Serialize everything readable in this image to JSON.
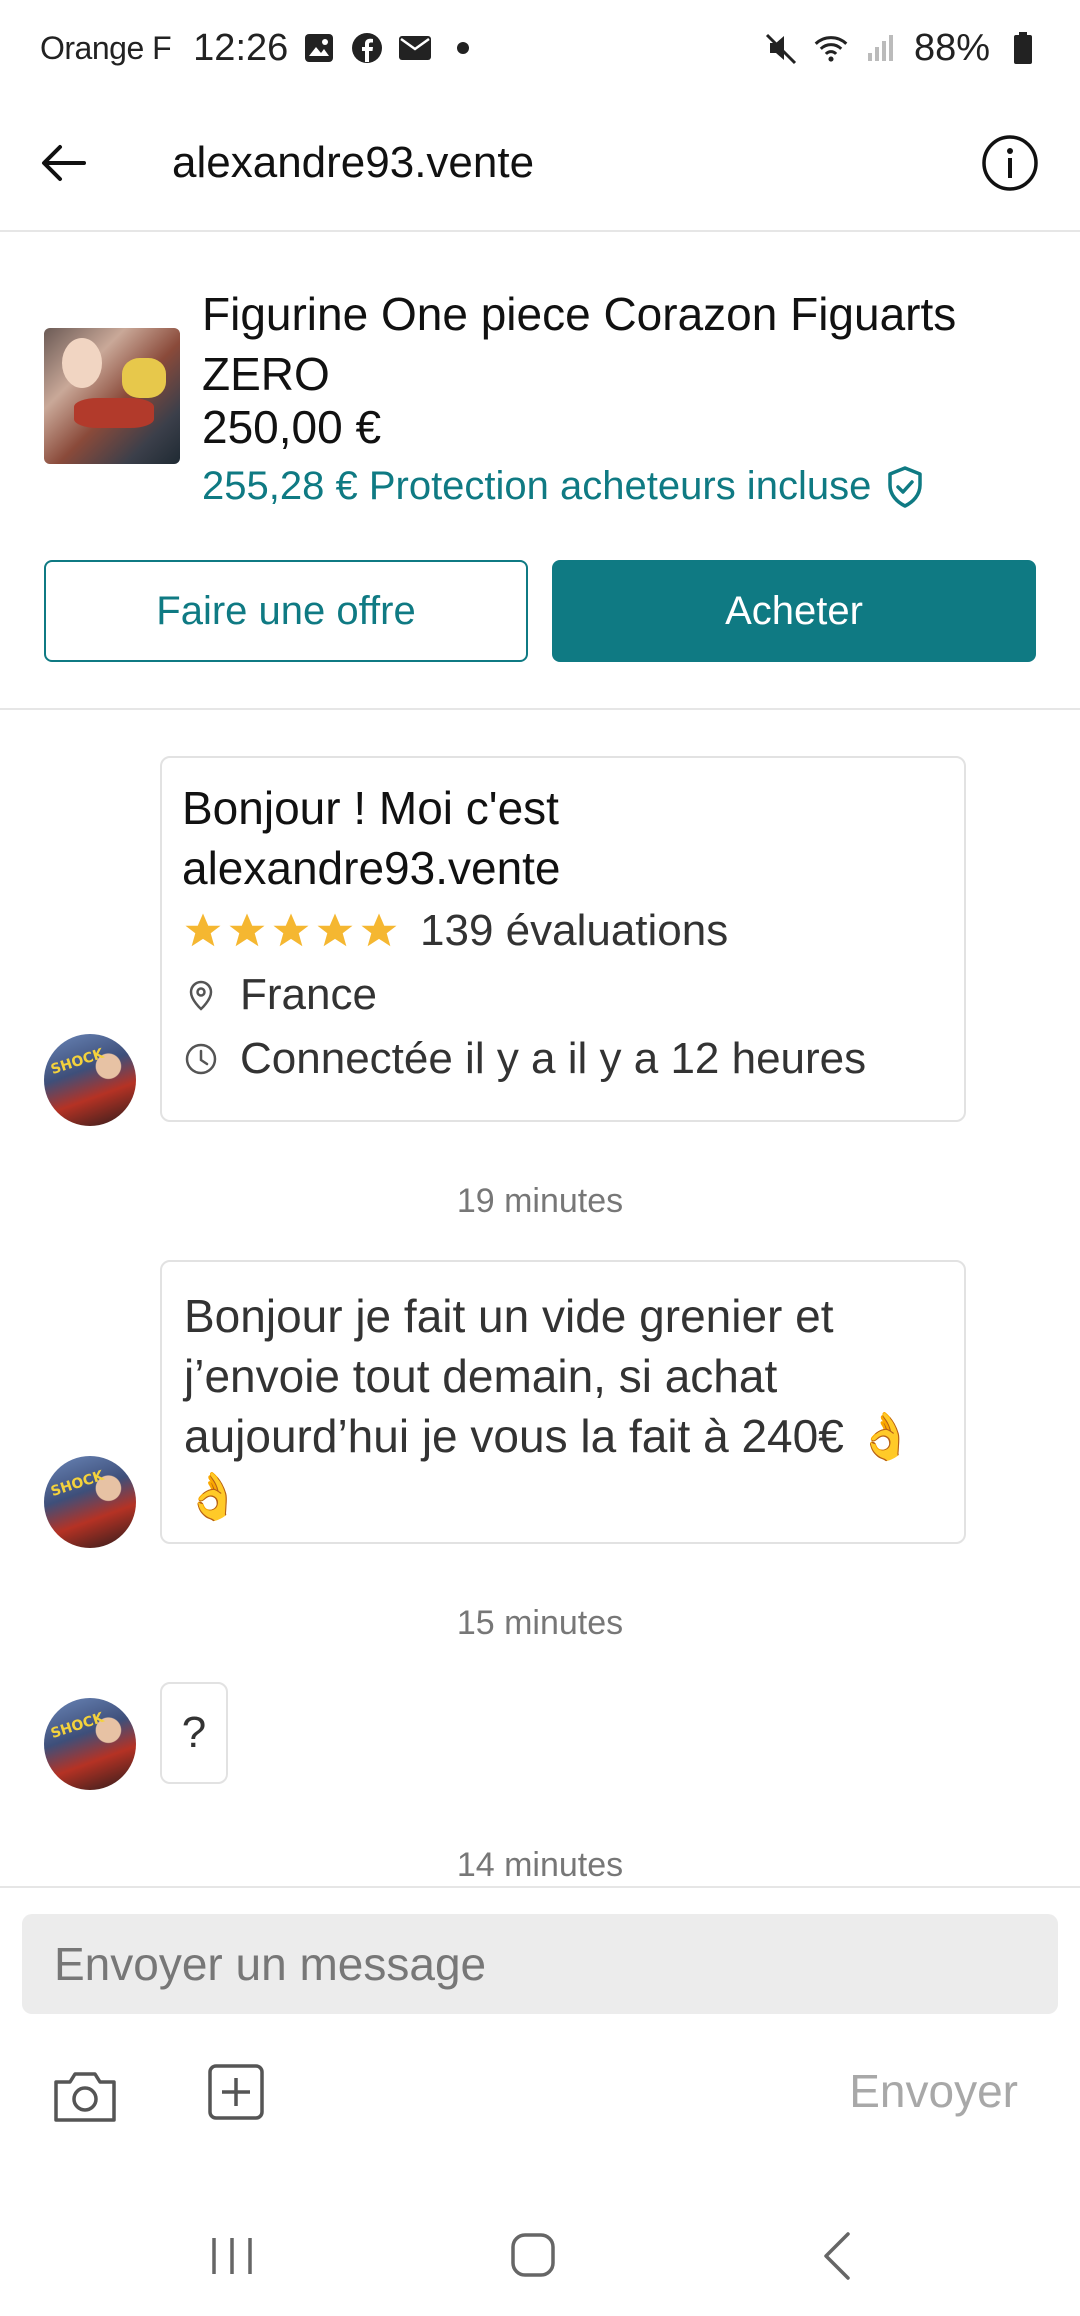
{
  "status_bar": {
    "carrier": "Orange F",
    "time": "12:26",
    "battery": "88%",
    "icons": [
      "gallery-icon",
      "facebook-icon",
      "mail-icon",
      "dot-icon",
      "mute-icon",
      "wifi-icon",
      "signal-icon",
      "battery-icon"
    ]
  },
  "header": {
    "title": "alexandre93.vente",
    "back_icon": "arrow-left-icon",
    "info_icon": "info-icon"
  },
  "item": {
    "title": "Figurine One piece Corazon Figuarts ZERO",
    "price": "250,00 €",
    "protection": "255,28 € Protection acheteurs incluse",
    "offer_label": "Faire une offre",
    "buy_label": "Acheter"
  },
  "conversation": {
    "intro": {
      "title": "Bonjour ! Moi c'est alexandre93.vente",
      "rating": 5,
      "reviews": "139 évaluations",
      "location": "France",
      "last_seen": "Connectée il y a il y a 12 heures"
    },
    "timestamps": [
      "19 minutes",
      "15 minutes",
      "14 minutes"
    ],
    "messages": [
      {
        "text": "Bonjour je fait un vide grenier et j’envoie tout demain, si achat aujourd’hui je vous la fait à 240€ 👌👌"
      },
      {
        "text": "?"
      }
    ],
    "avatar_text": "SHOCK"
  },
  "composer": {
    "placeholder": "Envoyer un message",
    "send_label": "Envoyer"
  },
  "colors": {
    "accent": "#0f7a83",
    "star": "#f5b731"
  }
}
